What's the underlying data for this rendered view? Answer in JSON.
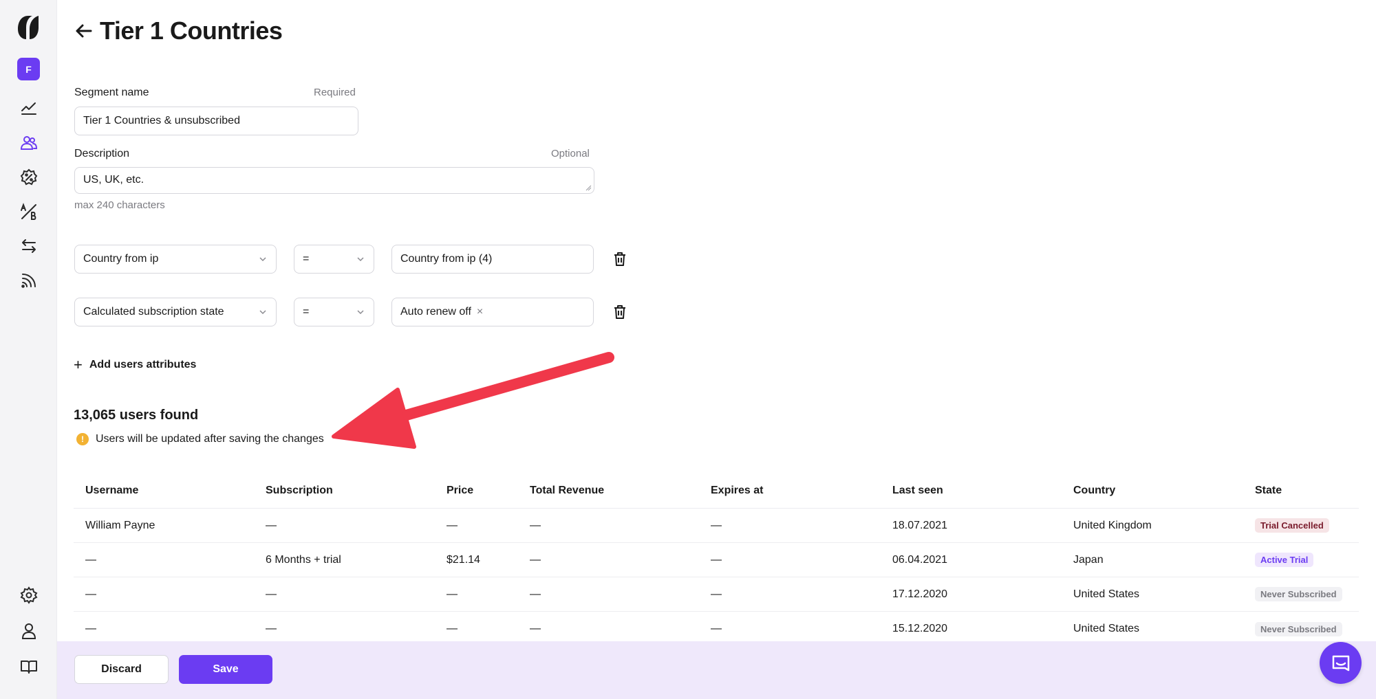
{
  "header": {
    "title": "Tier 1 Countries"
  },
  "sidebar": {
    "avatar_letter": "F",
    "items": [
      {
        "icon": "analytics-icon"
      },
      {
        "icon": "users-icon",
        "active": true
      },
      {
        "icon": "discount-icon"
      },
      {
        "icon": "ab-test-icon"
      },
      {
        "icon": "transfer-icon"
      },
      {
        "icon": "feed-icon"
      }
    ],
    "bottom": [
      {
        "icon": "gear-icon"
      },
      {
        "icon": "profile-icon"
      },
      {
        "icon": "book-icon"
      }
    ]
  },
  "form": {
    "segment_name_label": "Segment name",
    "segment_name_hint": "Required",
    "segment_name_value": "Tier 1 Countries & unsubscribed",
    "description_label": "Description",
    "description_hint": "Optional",
    "description_value": "US, UK, etc.",
    "description_limit": "max 240 characters"
  },
  "filters": [
    {
      "attribute": "Country from ip",
      "operator": "=",
      "value": "Country from ip (4)",
      "has_chip_close": false
    },
    {
      "attribute": "Calculated subscription state",
      "operator": "=",
      "value": "Auto renew off",
      "has_chip_close": true
    }
  ],
  "add_attributes_label": "Add users attributes",
  "results": {
    "count_text": "13,065 users found",
    "warning_text": "Users will be updated after saving the changes"
  },
  "table": {
    "columns": [
      "Username",
      "Subscription",
      "Price",
      "Total Revenue",
      "Expires at",
      "Last seen",
      "Country",
      "State"
    ],
    "rows": [
      {
        "username": "William Payne",
        "subscription": "—",
        "price": "—",
        "revenue": "—",
        "expires": "—",
        "last_seen": "18.07.2021",
        "country": "United Kingdom",
        "state": "Trial Cancelled",
        "state_bg": "#f6e4e6",
        "state_fg": "#7a1b2c"
      },
      {
        "username": "—",
        "subscription": "6 Months + trial",
        "price": "$21.14",
        "revenue": "—",
        "expires": "—",
        "last_seen": "06.04.2021",
        "country": "Japan",
        "state": "Active Trial",
        "state_bg": "#efe6fd",
        "state_fg": "#6b3cf2"
      },
      {
        "username": "—",
        "subscription": "—",
        "price": "—",
        "revenue": "—",
        "expires": "—",
        "last_seen": "17.12.2020",
        "country": "United States",
        "state": "Never Subscribed",
        "state_bg": "#f1f1f4",
        "state_fg": "#7a7a80"
      },
      {
        "username": "—",
        "subscription": "—",
        "price": "—",
        "revenue": "—",
        "expires": "—",
        "last_seen": "15.12.2020",
        "country": "United States",
        "state": "Never Subscribed",
        "state_bg": "#f1f1f4",
        "state_fg": "#7a7a80"
      }
    ]
  },
  "footer": {
    "discard_label": "Discard",
    "save_label": "Save"
  },
  "colors": {
    "accent": "#6b3cf2",
    "annotation": "#f0384a",
    "warning": "#f2b233",
    "footer_bg": "#efe8fb"
  }
}
